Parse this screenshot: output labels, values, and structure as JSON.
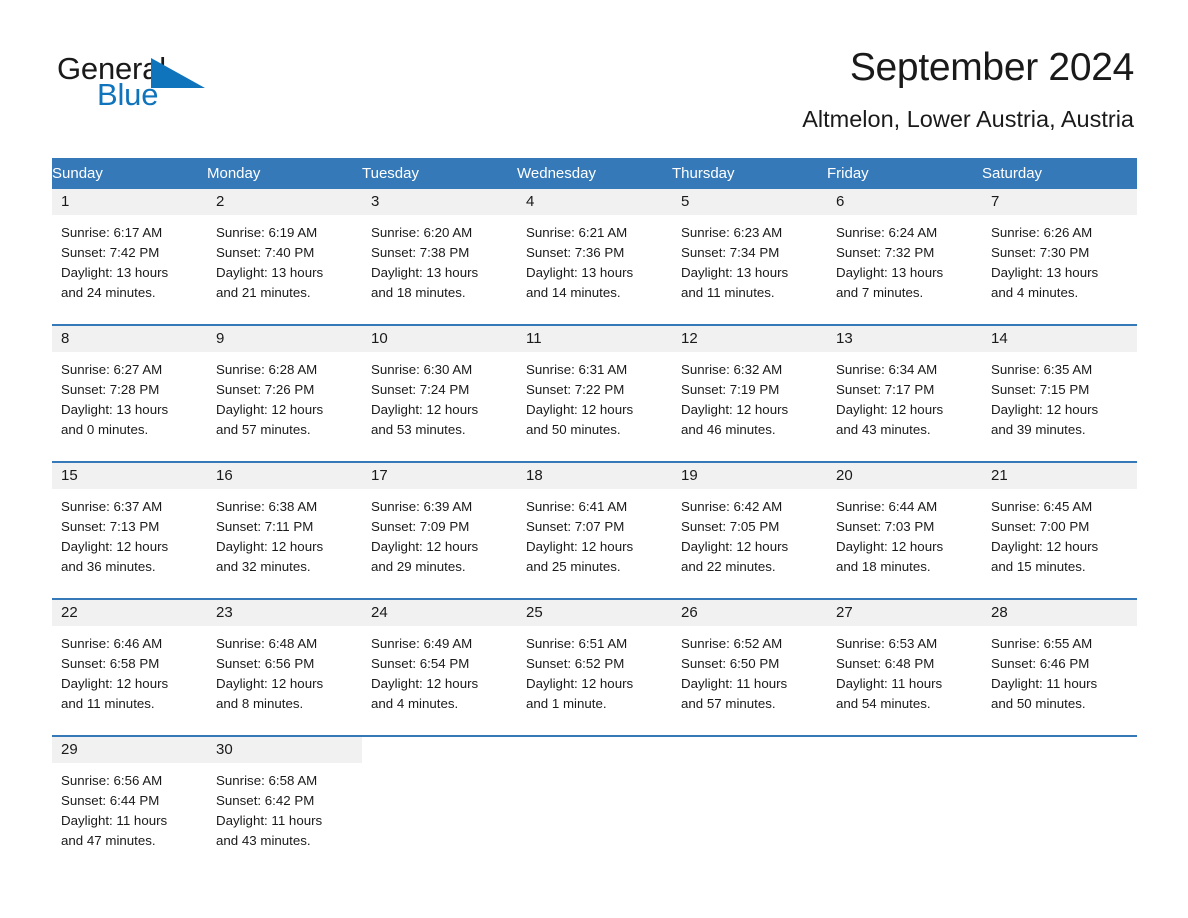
{
  "brand": {
    "name_part1": "General",
    "name_part2": "Blue",
    "triangle_color": "#1074bc",
    "text_color": "#1a1a1a"
  },
  "header": {
    "title": "September 2024",
    "subtitle": "Altmelon, Lower Austria, Austria"
  },
  "theme": {
    "header_bg": "#3579b8",
    "header_text": "#ffffff",
    "daynum_band_bg": "#f1f1f1",
    "row_divider": "#3579b8",
    "page_bg": "#ffffff",
    "body_text": "#1a1a1a"
  },
  "weekday_headers": [
    "Sunday",
    "Monday",
    "Tuesday",
    "Wednesday",
    "Thursday",
    "Friday",
    "Saturday"
  ],
  "labels": {
    "sunrise_prefix": "Sunrise:",
    "sunset_prefix": "Sunset:",
    "daylight_prefix": "Daylight:"
  },
  "weeks": [
    [
      {
        "day": "1",
        "sunrise": "Sunrise: 6:17 AM",
        "sunset": "Sunset: 7:42 PM",
        "daylight_line1": "Daylight: 13 hours",
        "daylight_line2": "and 24 minutes."
      },
      {
        "day": "2",
        "sunrise": "Sunrise: 6:19 AM",
        "sunset": "Sunset: 7:40 PM",
        "daylight_line1": "Daylight: 13 hours",
        "daylight_line2": "and 21 minutes."
      },
      {
        "day": "3",
        "sunrise": "Sunrise: 6:20 AM",
        "sunset": "Sunset: 7:38 PM",
        "daylight_line1": "Daylight: 13 hours",
        "daylight_line2": "and 18 minutes."
      },
      {
        "day": "4",
        "sunrise": "Sunrise: 6:21 AM",
        "sunset": "Sunset: 7:36 PM",
        "daylight_line1": "Daylight: 13 hours",
        "daylight_line2": "and 14 minutes."
      },
      {
        "day": "5",
        "sunrise": "Sunrise: 6:23 AM",
        "sunset": "Sunset: 7:34 PM",
        "daylight_line1": "Daylight: 13 hours",
        "daylight_line2": "and 11 minutes."
      },
      {
        "day": "6",
        "sunrise": "Sunrise: 6:24 AM",
        "sunset": "Sunset: 7:32 PM",
        "daylight_line1": "Daylight: 13 hours",
        "daylight_line2": "and 7 minutes."
      },
      {
        "day": "7",
        "sunrise": "Sunrise: 6:26 AM",
        "sunset": "Sunset: 7:30 PM",
        "daylight_line1": "Daylight: 13 hours",
        "daylight_line2": "and 4 minutes."
      }
    ],
    [
      {
        "day": "8",
        "sunrise": "Sunrise: 6:27 AM",
        "sunset": "Sunset: 7:28 PM",
        "daylight_line1": "Daylight: 13 hours",
        "daylight_line2": "and 0 minutes."
      },
      {
        "day": "9",
        "sunrise": "Sunrise: 6:28 AM",
        "sunset": "Sunset: 7:26 PM",
        "daylight_line1": "Daylight: 12 hours",
        "daylight_line2": "and 57 minutes."
      },
      {
        "day": "10",
        "sunrise": "Sunrise: 6:30 AM",
        "sunset": "Sunset: 7:24 PM",
        "daylight_line1": "Daylight: 12 hours",
        "daylight_line2": "and 53 minutes."
      },
      {
        "day": "11",
        "sunrise": "Sunrise: 6:31 AM",
        "sunset": "Sunset: 7:22 PM",
        "daylight_line1": "Daylight: 12 hours",
        "daylight_line2": "and 50 minutes."
      },
      {
        "day": "12",
        "sunrise": "Sunrise: 6:32 AM",
        "sunset": "Sunset: 7:19 PM",
        "daylight_line1": "Daylight: 12 hours",
        "daylight_line2": "and 46 minutes."
      },
      {
        "day": "13",
        "sunrise": "Sunrise: 6:34 AM",
        "sunset": "Sunset: 7:17 PM",
        "daylight_line1": "Daylight: 12 hours",
        "daylight_line2": "and 43 minutes."
      },
      {
        "day": "14",
        "sunrise": "Sunrise: 6:35 AM",
        "sunset": "Sunset: 7:15 PM",
        "daylight_line1": "Daylight: 12 hours",
        "daylight_line2": "and 39 minutes."
      }
    ],
    [
      {
        "day": "15",
        "sunrise": "Sunrise: 6:37 AM",
        "sunset": "Sunset: 7:13 PM",
        "daylight_line1": "Daylight: 12 hours",
        "daylight_line2": "and 36 minutes."
      },
      {
        "day": "16",
        "sunrise": "Sunrise: 6:38 AM",
        "sunset": "Sunset: 7:11 PM",
        "daylight_line1": "Daylight: 12 hours",
        "daylight_line2": "and 32 minutes."
      },
      {
        "day": "17",
        "sunrise": "Sunrise: 6:39 AM",
        "sunset": "Sunset: 7:09 PM",
        "daylight_line1": "Daylight: 12 hours",
        "daylight_line2": "and 29 minutes."
      },
      {
        "day": "18",
        "sunrise": "Sunrise: 6:41 AM",
        "sunset": "Sunset: 7:07 PM",
        "daylight_line1": "Daylight: 12 hours",
        "daylight_line2": "and 25 minutes."
      },
      {
        "day": "19",
        "sunrise": "Sunrise: 6:42 AM",
        "sunset": "Sunset: 7:05 PM",
        "daylight_line1": "Daylight: 12 hours",
        "daylight_line2": "and 22 minutes."
      },
      {
        "day": "20",
        "sunrise": "Sunrise: 6:44 AM",
        "sunset": "Sunset: 7:03 PM",
        "daylight_line1": "Daylight: 12 hours",
        "daylight_line2": "and 18 minutes."
      },
      {
        "day": "21",
        "sunrise": "Sunrise: 6:45 AM",
        "sunset": "Sunset: 7:00 PM",
        "daylight_line1": "Daylight: 12 hours",
        "daylight_line2": "and 15 minutes."
      }
    ],
    [
      {
        "day": "22",
        "sunrise": "Sunrise: 6:46 AM",
        "sunset": "Sunset: 6:58 PM",
        "daylight_line1": "Daylight: 12 hours",
        "daylight_line2": "and 11 minutes."
      },
      {
        "day": "23",
        "sunrise": "Sunrise: 6:48 AM",
        "sunset": "Sunset: 6:56 PM",
        "daylight_line1": "Daylight: 12 hours",
        "daylight_line2": "and 8 minutes."
      },
      {
        "day": "24",
        "sunrise": "Sunrise: 6:49 AM",
        "sunset": "Sunset: 6:54 PM",
        "daylight_line1": "Daylight: 12 hours",
        "daylight_line2": "and 4 minutes."
      },
      {
        "day": "25",
        "sunrise": "Sunrise: 6:51 AM",
        "sunset": "Sunset: 6:52 PM",
        "daylight_line1": "Daylight: 12 hours",
        "daylight_line2": "and 1 minute."
      },
      {
        "day": "26",
        "sunrise": "Sunrise: 6:52 AM",
        "sunset": "Sunset: 6:50 PM",
        "daylight_line1": "Daylight: 11 hours",
        "daylight_line2": "and 57 minutes."
      },
      {
        "day": "27",
        "sunrise": "Sunrise: 6:53 AM",
        "sunset": "Sunset: 6:48 PM",
        "daylight_line1": "Daylight: 11 hours",
        "daylight_line2": "and 54 minutes."
      },
      {
        "day": "28",
        "sunrise": "Sunrise: 6:55 AM",
        "sunset": "Sunset: 6:46 PM",
        "daylight_line1": "Daylight: 11 hours",
        "daylight_line2": "and 50 minutes."
      }
    ],
    [
      {
        "day": "29",
        "sunrise": "Sunrise: 6:56 AM",
        "sunset": "Sunset: 6:44 PM",
        "daylight_line1": "Daylight: 11 hours",
        "daylight_line2": "and 47 minutes."
      },
      {
        "day": "30",
        "sunrise": "Sunrise: 6:58 AM",
        "sunset": "Sunset: 6:42 PM",
        "daylight_line1": "Daylight: 11 hours",
        "daylight_line2": "and 43 minutes."
      },
      {
        "day": "",
        "sunrise": "",
        "sunset": "",
        "daylight_line1": "",
        "daylight_line2": "",
        "blank": true
      },
      {
        "day": "",
        "sunrise": "",
        "sunset": "",
        "daylight_line1": "",
        "daylight_line2": "",
        "blank": true
      },
      {
        "day": "",
        "sunrise": "",
        "sunset": "",
        "daylight_line1": "",
        "daylight_line2": "",
        "blank": true
      },
      {
        "day": "",
        "sunrise": "",
        "sunset": "",
        "daylight_line1": "",
        "daylight_line2": "",
        "blank": true
      },
      {
        "day": "",
        "sunrise": "",
        "sunset": "",
        "daylight_line1": "",
        "daylight_line2": "",
        "blank": true
      }
    ]
  ]
}
